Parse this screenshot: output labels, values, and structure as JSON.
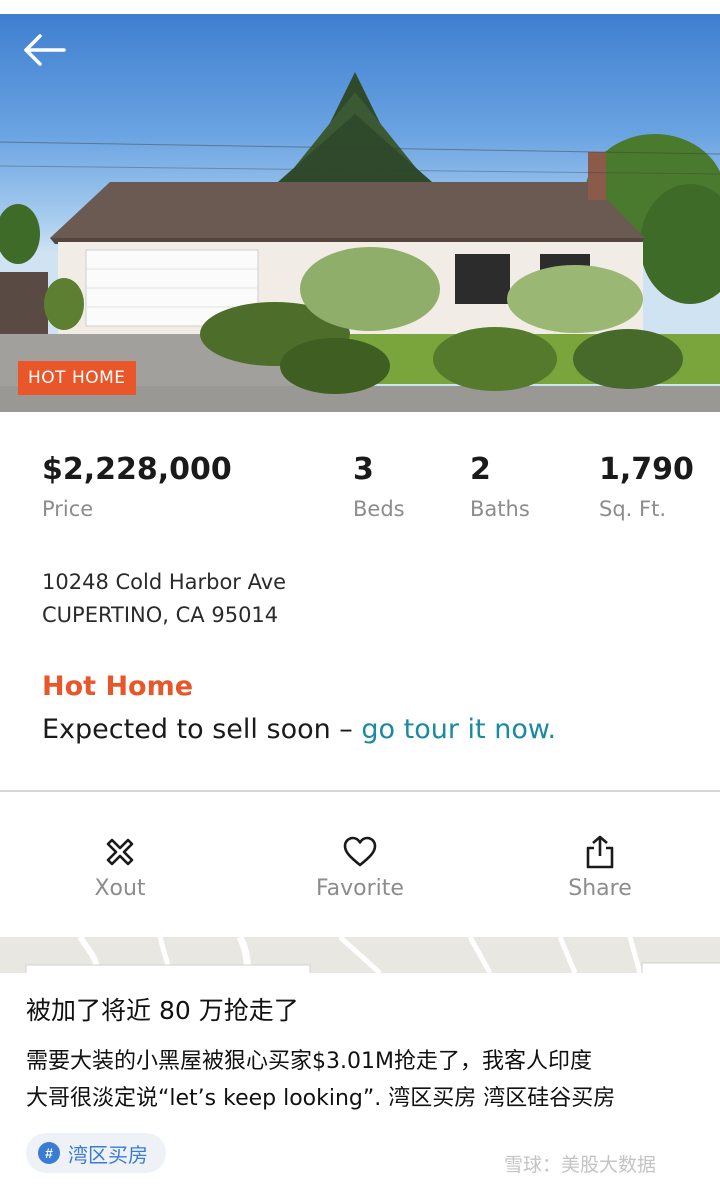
{
  "listing": {
    "badge": "HOT HOME",
    "stats": {
      "price": {
        "value": "$2,228,000",
        "label": "Price"
      },
      "beds": {
        "value": "3",
        "label": "Beds"
      },
      "baths": {
        "value": "2",
        "label": "Baths"
      },
      "sqft": {
        "value": "1,790",
        "label": "Sq. Ft."
      }
    },
    "address_line1": "10248 Cold Harbor Ave",
    "address_line2": "CUPERTINO, CA 95014",
    "hot_home_title": "Hot Home",
    "hot_home_text": "Expected to sell soon – ",
    "hot_home_link": "go tour it now."
  },
  "actions": [
    {
      "label": "Xout",
      "icon": "x-out-icon"
    },
    {
      "label": "Favorite",
      "icon": "heart-icon"
    },
    {
      "label": "Share",
      "icon": "share-icon"
    }
  ],
  "post": {
    "title": "被加了将近 80 万抢走了",
    "body_line1": "需要大装的小黑屋被狠心买家$3.01M抢走了，我客人印度",
    "body_line2": "大哥很淡定说“let’s keep looking”. 湾区买房  湾区硅谷买房",
    "tag": "湾区买房",
    "watermark": "雪球：美股大数据"
  },
  "colors": {
    "accent": "#e8562a",
    "link": "#1a8aa0",
    "tag": "#3a7bd5"
  }
}
